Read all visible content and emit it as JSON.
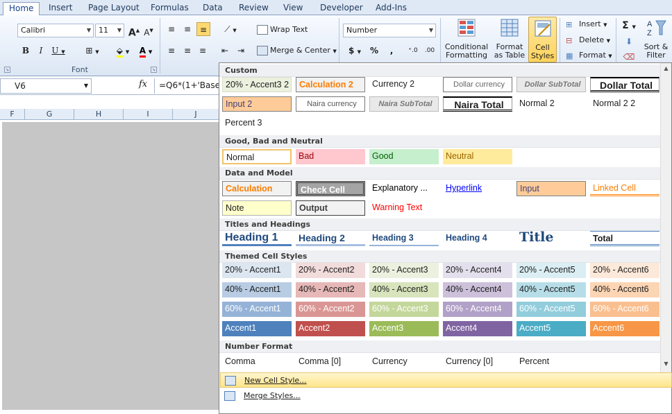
{
  "tabs": [
    "Home",
    "Insert",
    "Page Layout",
    "Formulas",
    "Data",
    "Review",
    "View",
    "Developer",
    "Add-Ins"
  ],
  "font": {
    "name": "Calibri",
    "size": "11",
    "group_label": "Font"
  },
  "alignment": {
    "wrap_text": "Wrap Text",
    "merge_center": "Merge & Center"
  },
  "number": {
    "format": "Number",
    "currency_symbol": "$",
    "percent_symbol": "%",
    "comma_symbol": ","
  },
  "styles": {
    "conditional": "Conditional\nFormatting",
    "format_table": "Format\nas Table",
    "cell_styles": "Cell\nStyles"
  },
  "cells_group": {
    "insert": "Insert",
    "delete": "Delete",
    "format": "Format"
  },
  "editing": {
    "sort_filter": "Sort &\nFilter"
  },
  "formula_bar": {
    "name_box": "V6",
    "fx": "fx",
    "formula": "=Q6*(1+'Base"
  },
  "columns": [
    "F",
    "G",
    "H",
    "I",
    "J"
  ],
  "gallery": {
    "sections": [
      {
        "title": "Custom",
        "rows": [
          [
            "20% - Accent3 2",
            "Calculation 2",
            "Currency 2",
            "Dollar currency",
            "Dollar SubTotal",
            "Dollar Total"
          ],
          [
            "Input 2",
            "Naira currency",
            "Naira SubTotal",
            "Naira Total",
            "Normal 2",
            "Normal 2 2"
          ],
          [
            "Percent 3"
          ]
        ]
      },
      {
        "title": "Good, Bad and Neutral",
        "rows": [
          [
            "Normal",
            "Bad",
            "Good",
            "Neutral"
          ]
        ]
      },
      {
        "title": "Data and Model",
        "rows": [
          [
            "Calculation",
            "Check Cell",
            "Explanatory ...",
            "Hyperlink",
            "Input",
            "Linked Cell"
          ],
          [
            "Note",
            "Output",
            "Warning Text"
          ]
        ]
      },
      {
        "title": "Titles and Headings",
        "rows": [
          [
            "Heading 1",
            "Heading 2",
            "Heading 3",
            "Heading 4",
            "Title",
            "Total"
          ]
        ]
      },
      {
        "title": "Themed Cell Styles",
        "rows": [
          [
            "20% - Accent1",
            "20% - Accent2",
            "20% - Accent3",
            "20% - Accent4",
            "20% - Accent5",
            "20% - Accent6"
          ],
          [
            "40% - Accent1",
            "40% - Accent2",
            "40% - Accent3",
            "40% - Accent4",
            "40% - Accent5",
            "40% - Accent6"
          ],
          [
            "60% - Accent1",
            "60% - Accent2",
            "60% - Accent3",
            "60% - Accent4",
            "60% - Accent5",
            "60% - Accent6"
          ],
          [
            "Accent1",
            "Accent2",
            "Accent3",
            "Accent4",
            "Accent5",
            "Accent6"
          ]
        ]
      },
      {
        "title": "Number Format",
        "rows": [
          [
            "Comma",
            "Comma [0]",
            "Currency",
            "Currency [0]",
            "Percent"
          ]
        ]
      }
    ],
    "menu": {
      "new_style": "New Cell Style...",
      "merge_styles": "Merge Styles..."
    }
  },
  "colors": {
    "accent1": "#4f81bd",
    "accent2": "#c0504d",
    "accent3": "#9bbb59",
    "accent4": "#8064a2",
    "accent5": "#4bacc6",
    "accent6": "#f79646"
  }
}
